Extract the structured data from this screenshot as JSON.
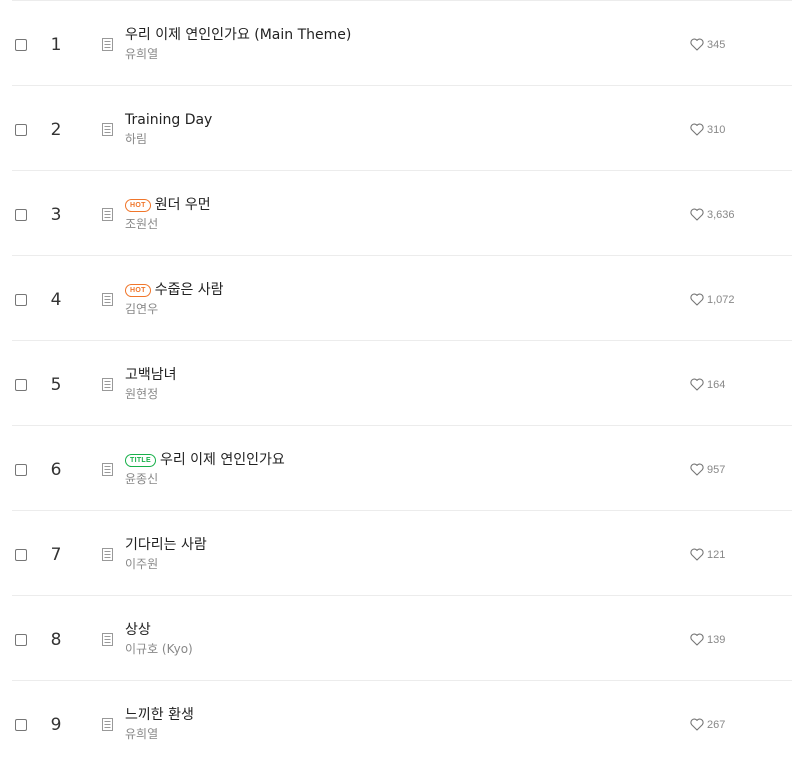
{
  "tracks": [
    {
      "number": "1",
      "title": "우리 이제 연인인가요 (Main Theme)",
      "artist": "유희열",
      "likes": "345",
      "badge": ""
    },
    {
      "number": "2",
      "title": "Training Day",
      "artist": "하림",
      "likes": "310",
      "badge": ""
    },
    {
      "number": "3",
      "title": "원더 우먼",
      "artist": "조원선",
      "likes": "3,636",
      "badge": "HOT"
    },
    {
      "number": "4",
      "title": "수줍은 사람",
      "artist": "김연우",
      "likes": "1,072",
      "badge": "HOT"
    },
    {
      "number": "5",
      "title": "고백남녀",
      "artist": "원현정",
      "likes": "164",
      "badge": ""
    },
    {
      "number": "6",
      "title": "우리 이제 연인인가요",
      "artist": "윤종신",
      "likes": "957",
      "badge": "TITLE"
    },
    {
      "number": "7",
      "title": "기다리는 사람",
      "artist": "이주원",
      "likes": "121",
      "badge": ""
    },
    {
      "number": "8",
      "title": "상상",
      "artist": "이규호 (Kyo)",
      "likes": "139",
      "badge": ""
    },
    {
      "number": "9",
      "title": "느끼한 환생",
      "artist": "유희열",
      "likes": "267",
      "badge": ""
    }
  ],
  "colors": {
    "hot_badge": "#f0762b",
    "title_badge": "#18b04a",
    "divider": "#ececec",
    "secondary_text": "#888888"
  },
  "icons": {
    "lyrics": "lyrics-document-icon",
    "like": "heart-outline-icon"
  }
}
